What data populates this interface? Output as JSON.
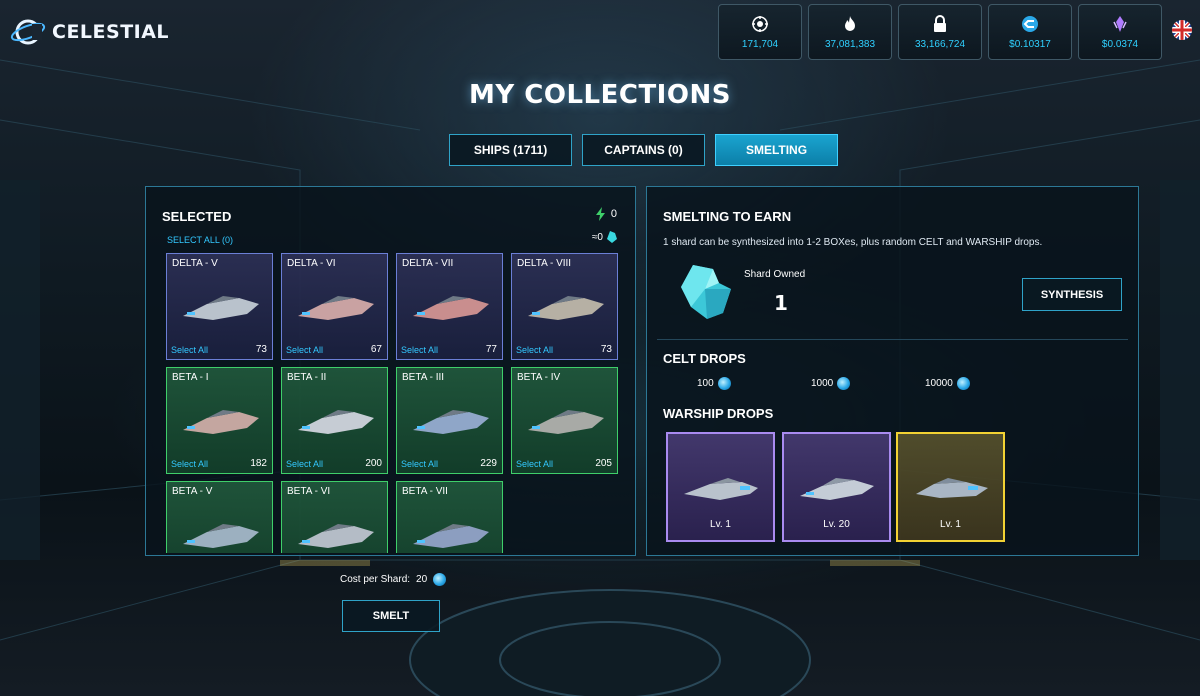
{
  "brand": {
    "name": "CELESTIAL"
  },
  "stats": [
    {
      "icon": "helm-icon",
      "value": "171,704"
    },
    {
      "icon": "flame-icon",
      "value": "37,081,383"
    },
    {
      "icon": "lock-icon",
      "value": "33,166,724"
    },
    {
      "icon": "celt-coin-icon",
      "value": "$0.10317"
    },
    {
      "icon": "crystal-icon",
      "value": "$0.0374"
    }
  ],
  "language": {
    "icon": "uk-flag-icon"
  },
  "page": {
    "title": "MY COLLECTIONS"
  },
  "tabs": [
    {
      "label": "SHIPS (1711)",
      "active": false
    },
    {
      "label": "CAPTAINS (0)",
      "active": false
    },
    {
      "label": "SMELTING",
      "active": true
    }
  ],
  "selected_panel": {
    "title": "SELECTED",
    "select_all": "SELECT ALL (0)",
    "shard_count": "0",
    "approx_label": "≈0",
    "cards": [
      {
        "name": "DELTA - V",
        "select_label": "Select All",
        "count": "73",
        "tier": "purple"
      },
      {
        "name": "DELTA - VI",
        "select_label": "Select All",
        "count": "67",
        "tier": "purple"
      },
      {
        "name": "DELTA - VII",
        "select_label": "Select All",
        "count": "77",
        "tier": "purple"
      },
      {
        "name": "DELTA - VIII",
        "select_label": "Select All",
        "count": "73",
        "tier": "purple"
      },
      {
        "name": "BETA - I",
        "select_label": "Select All",
        "count": "182",
        "tier": "green"
      },
      {
        "name": "BETA - II",
        "select_label": "Select All",
        "count": "200",
        "tier": "green"
      },
      {
        "name": "BETA - III",
        "select_label": "Select All",
        "count": "229",
        "tier": "green"
      },
      {
        "name": "BETA - IV",
        "select_label": "Select All",
        "count": "205",
        "tier": "green"
      },
      {
        "name": "BETA - V",
        "select_label": "",
        "count": "",
        "tier": "green"
      },
      {
        "name": "BETA - VI",
        "select_label": "",
        "count": "",
        "tier": "green"
      },
      {
        "name": "BETA - VII",
        "select_label": "",
        "count": "",
        "tier": "green"
      }
    ]
  },
  "smelt": {
    "cost_label": "Cost per Shard:",
    "cost_value": "20",
    "button_label": "SMELT"
  },
  "smelting_panel": {
    "title": "SMELTING TO EARN",
    "description": "1 shard can be synthesized into 1-2 BOXes, plus random CELT and WARSHIP drops.",
    "shard_owned_label": "Shard Owned",
    "shard_owned_value": "1",
    "synthesis_label": "SYNTHESIS",
    "celt_drops_title": "CELT DROPS",
    "celt_drops": [
      "100",
      "1000",
      "10000"
    ],
    "warship_drops_title": "WARSHIP DROPS",
    "warship_drops": [
      {
        "level": "Lv. 1",
        "tier": "purple"
      },
      {
        "level": "Lv. 20",
        "tier": "purple"
      },
      {
        "level": "Lv. 1",
        "tier": "gold"
      }
    ]
  },
  "colors": {
    "accent": "#2fd0ff",
    "panel_border": "#2c7896",
    "tab_active": "#1aa4d0",
    "tier_purple": "#6b7fd6",
    "tier_green": "#3fcf6a",
    "tier_gold": "#f2d233"
  }
}
